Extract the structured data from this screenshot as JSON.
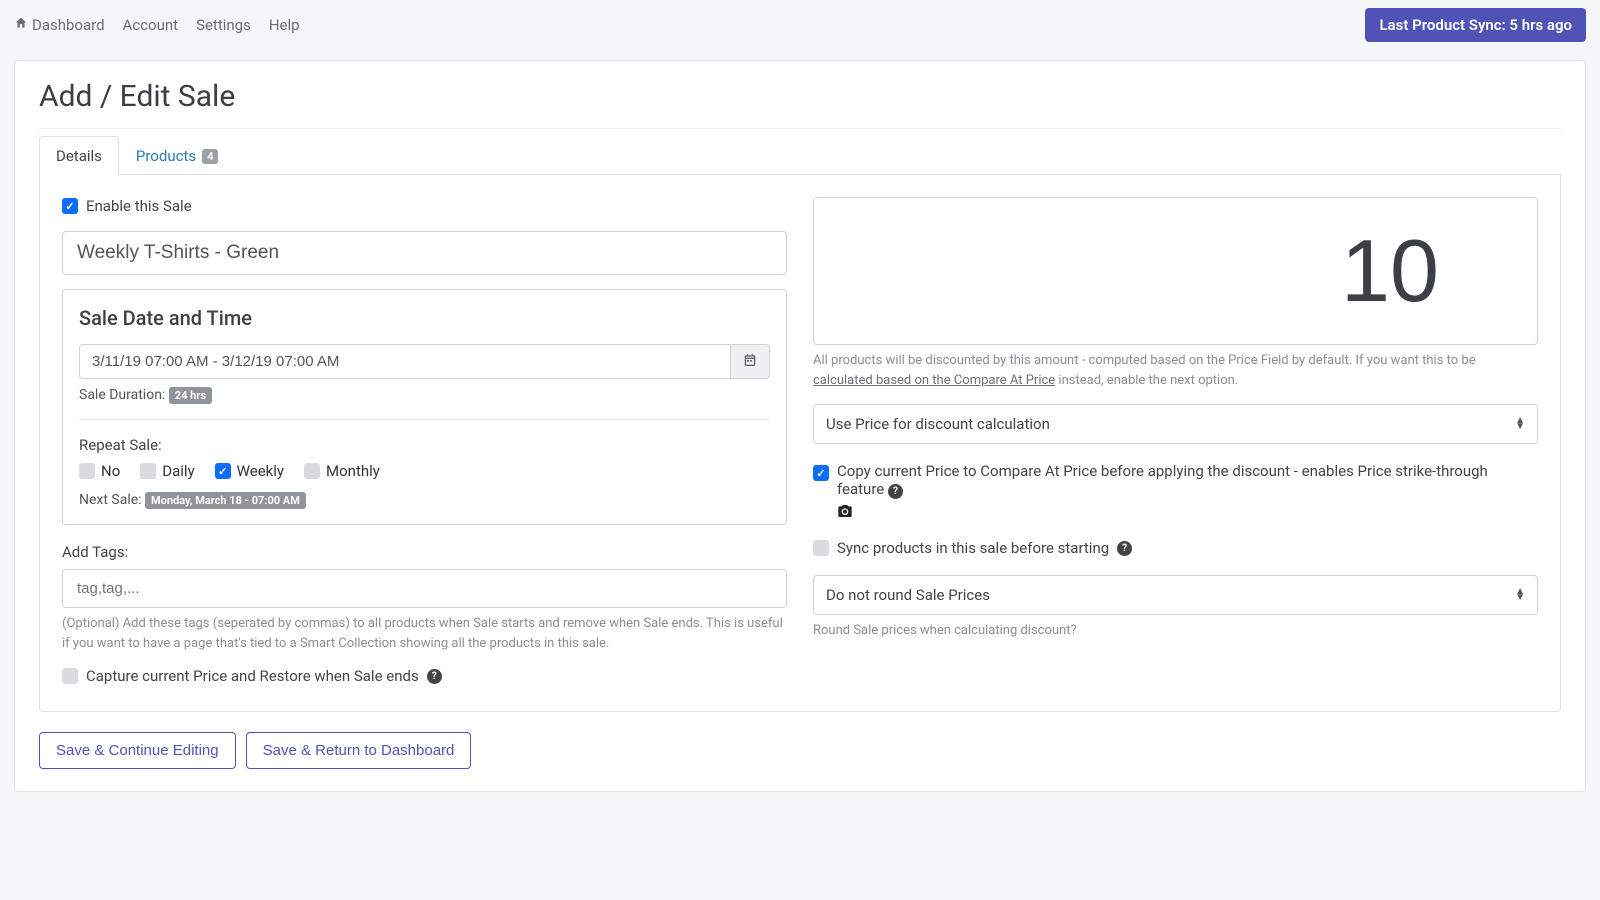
{
  "topnav": {
    "dashboard": "Dashboard",
    "account": "Account",
    "settings": "Settings",
    "help": "Help"
  },
  "sync_badge": "Last Product Sync: 5 hrs ago",
  "page_title": "Add / Edit Sale",
  "tabs": {
    "details": "Details",
    "products": "Products",
    "products_count": "4"
  },
  "left": {
    "enable_label": "Enable this Sale",
    "sale_name": "Weekly T-Shirts - Green",
    "date_card_title": "Sale Date and Time",
    "date_range": "3/11/19 07:00 AM - 3/12/19 07:00 AM",
    "duration_label": "Sale Duration:",
    "duration_value": "24 hrs",
    "repeat_label": "Repeat Sale:",
    "repeat_options": {
      "no": "No",
      "daily": "Daily",
      "weekly": "Weekly",
      "monthly": "Monthly"
    },
    "next_label": "Next Sale:",
    "next_value": "Monday, March 18 - 07:00 AM",
    "tags_label": "Add Tags:",
    "tags_placeholder": "tag,tag,...",
    "tags_help": "(Optional) Add these tags (seperated by commas) to all products when Sale starts and remove when Sale ends. This is useful if you want to have a page that's tied to a Smart Collection showing all the products in this sale.",
    "capture_label": "Capture current Price and Restore when Sale ends"
  },
  "right": {
    "discount_value": "10",
    "discount_unit": "%",
    "discount_help_pre": "All products will be discounted by this amount - computed based on the Price Field by default. If you want this to be ",
    "discount_help_link": "calculated based on the Compare At Price",
    "discount_help_post": " instead, enable the next option.",
    "price_mode_selected": "Use Price for discount calculation",
    "copy_compare_label": "Copy current Price to Compare At Price before applying the discount - enables Price strike-through feature",
    "sync_label": "Sync products in this sale before starting",
    "round_selected": "Do not round Sale Prices",
    "round_help": "Round Sale prices when calculating discount?"
  },
  "actions": {
    "save_continue": "Save & Continue Editing",
    "save_return": "Save & Return to Dashboard"
  }
}
